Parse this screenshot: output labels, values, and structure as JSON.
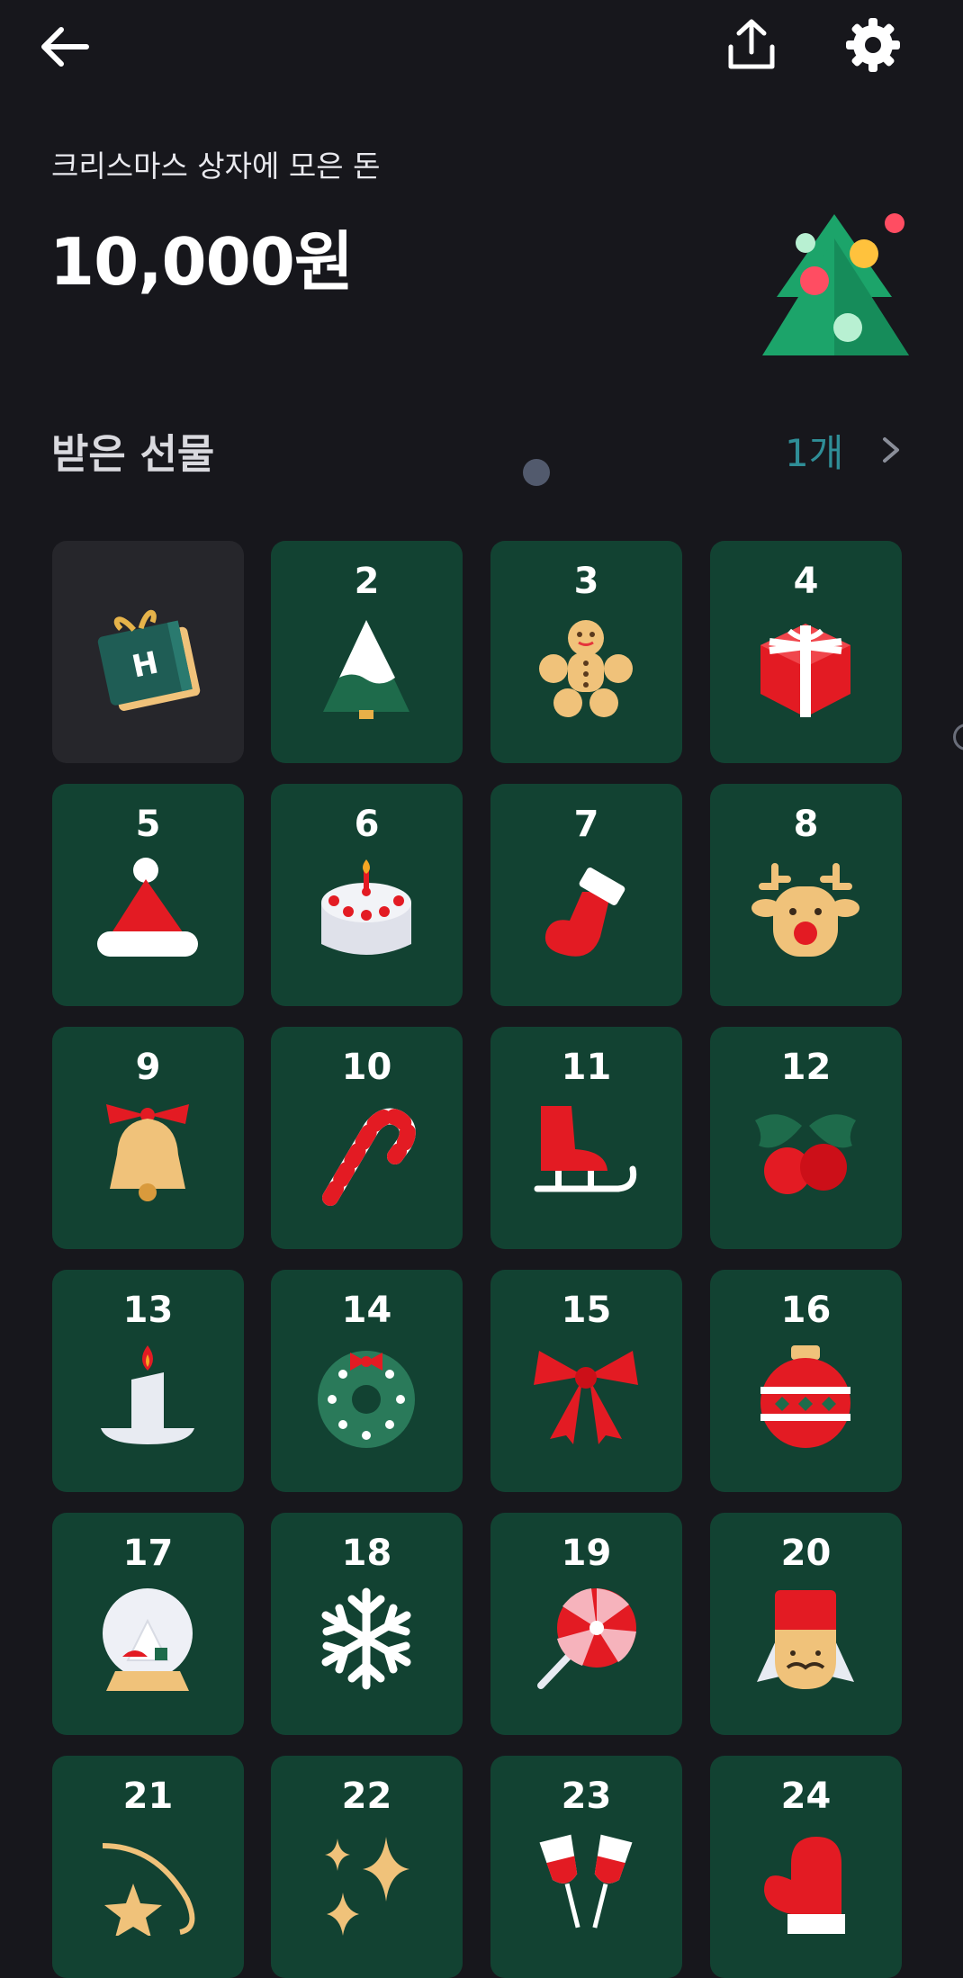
{
  "header": {
    "back_icon": "arrow-left-icon",
    "share_icon": "share-upload-icon",
    "settings_icon": "gear-icon"
  },
  "summary": {
    "subtitle": "크리스마스 상자에 모은 돈",
    "amount": "10,000원",
    "illustration": "christmas-tree-icon"
  },
  "gifts": {
    "title": "받은 선물",
    "count": "1개"
  },
  "calendar": [
    {
      "day": "",
      "icon": "gift-box-icon",
      "opened": true
    },
    {
      "day": "2",
      "icon": "snowy-tree-icon"
    },
    {
      "day": "3",
      "icon": "gingerbread-man-icon"
    },
    {
      "day": "4",
      "icon": "present-icon"
    },
    {
      "day": "5",
      "icon": "santa-hat-icon"
    },
    {
      "day": "6",
      "icon": "cake-icon"
    },
    {
      "day": "7",
      "icon": "stocking-icon"
    },
    {
      "day": "8",
      "icon": "reindeer-icon"
    },
    {
      "day": "9",
      "icon": "bell-icon"
    },
    {
      "day": "10",
      "icon": "candy-cane-icon"
    },
    {
      "day": "11",
      "icon": "sled-icon"
    },
    {
      "day": "12",
      "icon": "holly-icon"
    },
    {
      "day": "13",
      "icon": "candle-icon"
    },
    {
      "day": "14",
      "icon": "wreath-icon"
    },
    {
      "day": "15",
      "icon": "ribbon-bow-icon"
    },
    {
      "day": "16",
      "icon": "ornament-icon"
    },
    {
      "day": "17",
      "icon": "snow-globe-icon"
    },
    {
      "day": "18",
      "icon": "snowflake-icon"
    },
    {
      "day": "19",
      "icon": "lollipop-icon"
    },
    {
      "day": "20",
      "icon": "nutcracker-icon"
    },
    {
      "day": "21",
      "icon": "shooting-star-icon"
    },
    {
      "day": "22",
      "icon": "sparkles-icon"
    },
    {
      "day": "23",
      "icon": "wine-glasses-icon"
    },
    {
      "day": "24",
      "icon": "mitten-icon"
    }
  ],
  "colors": {
    "background": "#17171c",
    "cell": "#124232",
    "opened_cell": "#26262b",
    "accent": "#2f8e97"
  }
}
